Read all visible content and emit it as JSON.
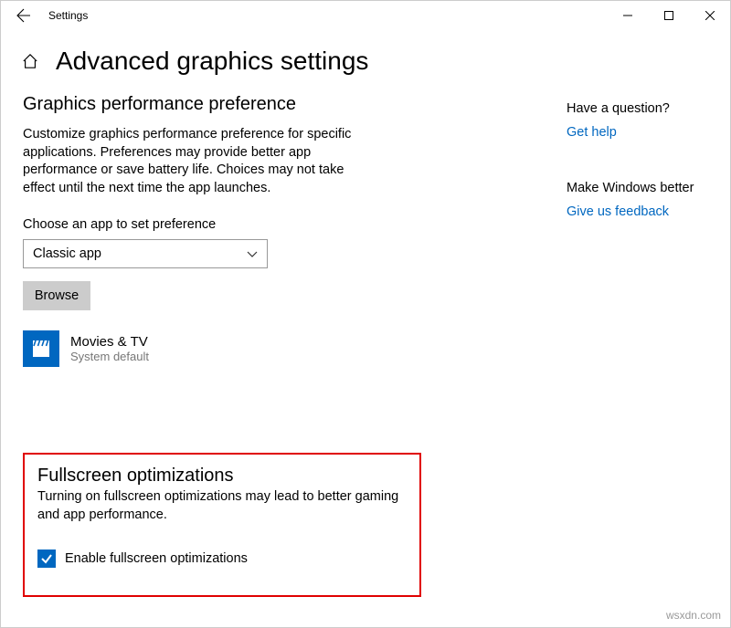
{
  "titlebar": {
    "title": "Settings"
  },
  "page": {
    "title": "Advanced graphics settings"
  },
  "perf": {
    "heading": "Graphics performance preference",
    "desc": "Customize graphics performance preference for specific applications. Preferences may provide better app performance or save battery life. Choices may not take effect until the next time the app launches.",
    "choose_label": "Choose an app to set preference",
    "combo_value": "Classic app",
    "browse_label": "Browse",
    "app": {
      "name": "Movies & TV",
      "sub": "System default"
    }
  },
  "side": {
    "q_heading": "Have a question?",
    "help_link": "Get help",
    "better_heading": "Make Windows better",
    "feedback_link": "Give us feedback"
  },
  "fullscreen": {
    "heading": "Fullscreen optimizations",
    "desc": "Turning on fullscreen optimizations may lead to better gaming and app performance.",
    "checkbox_label": "Enable fullscreen optimizations"
  },
  "watermark": "wsxdn.com"
}
